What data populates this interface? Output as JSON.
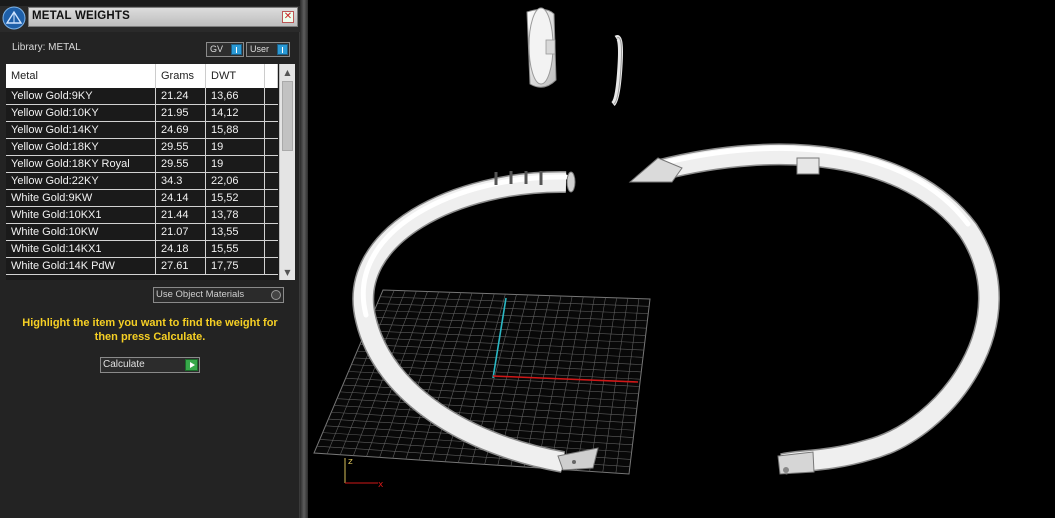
{
  "window": {
    "title": "METAL WEIGHTS"
  },
  "panel": {
    "library_label": "Library: METAL",
    "toggles": {
      "gv": "GV",
      "user": "User"
    },
    "columns": [
      "Metal",
      "Grams",
      "DWT"
    ],
    "rows": [
      {
        "metal": "Yellow Gold:9KY",
        "grams": "21.24",
        "dwt": "13,66"
      },
      {
        "metal": "Yellow Gold:10KY",
        "grams": "21.95",
        "dwt": "14,12"
      },
      {
        "metal": "Yellow Gold:14KY",
        "grams": "24.69",
        "dwt": "15,88"
      },
      {
        "metal": "Yellow Gold:18KY",
        "grams": "29.55",
        "dwt": "19"
      },
      {
        "metal": "Yellow Gold:18KY Royal",
        "grams": "29.55",
        "dwt": "19"
      },
      {
        "metal": "Yellow Gold:22KY",
        "grams": "34.3",
        "dwt": "22,06"
      },
      {
        "metal": "White Gold:9KW",
        "grams": "24.14",
        "dwt": "15,52"
      },
      {
        "metal": "White Gold:10KX1",
        "grams": "21.44",
        "dwt": "13,78"
      },
      {
        "metal": "White Gold:10KW",
        "grams": "21.07",
        "dwt": "13,55"
      },
      {
        "metal": "White Gold:14KX1",
        "grams": "24.18",
        "dwt": "15,55"
      },
      {
        "metal": "White Gold:14K PdW",
        "grams": "27.61",
        "dwt": "17,75"
      }
    ],
    "use_object_materials": "Use Object Materials",
    "hint": "Highlight the item you want to find the weight for then press Calculate.",
    "calculate_label": "Calculate"
  },
  "viewport": {
    "axis_labels": {
      "z": "z",
      "x": "x"
    }
  },
  "colors": {
    "panel_bg": "#232323",
    "hint_yellow": "#f6d024",
    "toggle_blue": "#2a9ad6",
    "go_green": "#37a84a",
    "axis_red": "#d01818",
    "axis_cyan": "#2bb8c4"
  }
}
